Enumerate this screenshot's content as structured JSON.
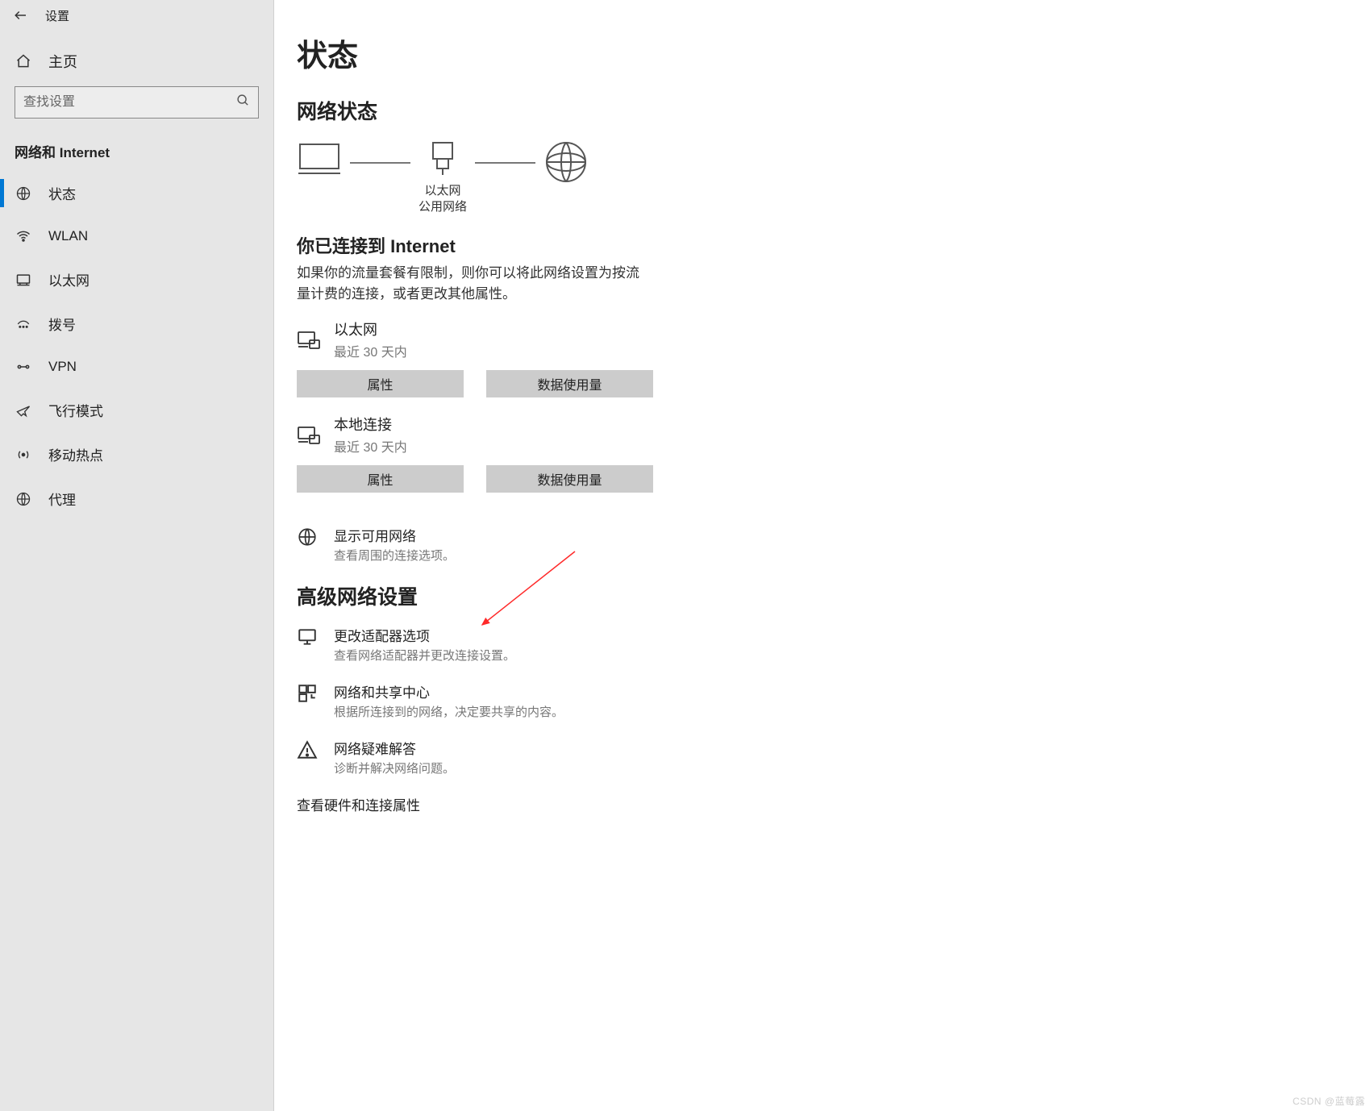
{
  "title": "设置",
  "sidebar": {
    "home": "主页",
    "search_placeholder": "查找设置",
    "section": "网络和 Internet",
    "items": [
      {
        "label": "状态",
        "active": true
      },
      {
        "label": "WLAN"
      },
      {
        "label": "以太网"
      },
      {
        "label": "拨号"
      },
      {
        "label": "VPN"
      },
      {
        "label": "飞行模式"
      },
      {
        "label": "移动热点"
      },
      {
        "label": "代理"
      }
    ]
  },
  "main": {
    "page_title": "状态",
    "network_status_h": "网络状态",
    "diagram": {
      "adapter_name": "以太网",
      "adapter_type": "公用网络"
    },
    "connected_h": "你已连接到 Internet",
    "connected_desc": "如果你的流量套餐有限制，则你可以将此网络设置为按流量计费的连接，或者更改其他属性。",
    "connections": [
      {
        "name": "以太网",
        "sub": "最近 30 天内",
        "btn_props": "属性",
        "btn_usage": "数据使用量"
      },
      {
        "name": "本地连接",
        "sub": "最近 30 天内",
        "btn_props": "属性",
        "btn_usage": "数据使用量"
      }
    ],
    "show_networks": {
      "title": "显示可用网络",
      "desc": "查看周围的连接选项。"
    },
    "advanced_h": "高级网络设置",
    "advanced_links": [
      {
        "title": "更改适配器选项",
        "desc": "查看网络适配器并更改连接设置。"
      },
      {
        "title": "网络和共享中心",
        "desc": "根据所连接到的网络，决定要共享的内容。"
      },
      {
        "title": "网络疑难解答",
        "desc": "诊断并解决网络问题。"
      }
    ],
    "extra_link": "查看硬件和连接属性"
  },
  "watermark": "CSDN @蓝莓露"
}
